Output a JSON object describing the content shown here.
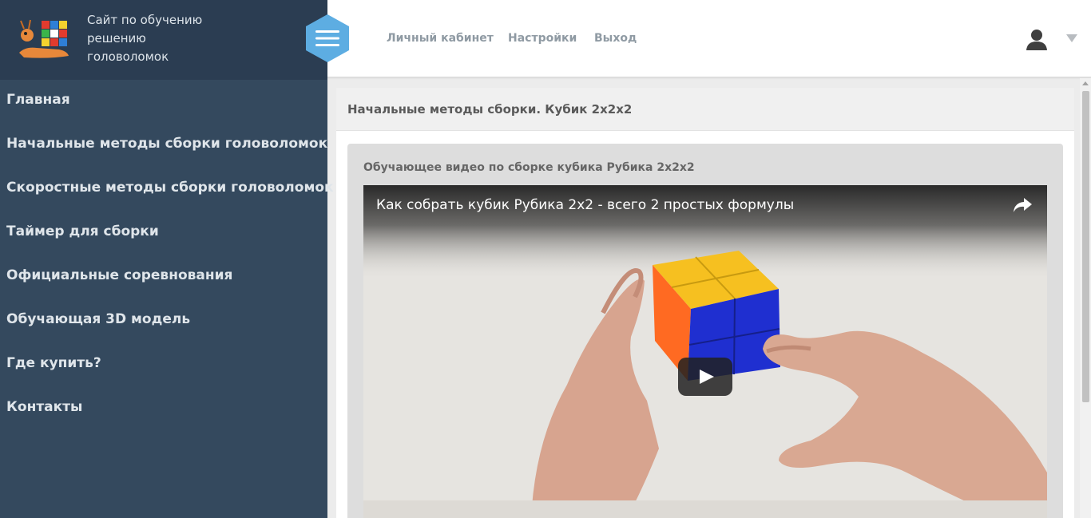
{
  "brand": {
    "line1": "Сайт по обучению",
    "line2": "решению",
    "line3": "головоломок"
  },
  "sidebar": {
    "items": [
      {
        "label": "Главная"
      },
      {
        "label": "Начальные методы сборки головоломок"
      },
      {
        "label": "Скоростные методы сборки головоломок"
      },
      {
        "label": "Таймер для сборки"
      },
      {
        "label": "Официальные соревнования"
      },
      {
        "label": "Обучающая 3D модель"
      },
      {
        "label": "Где купить?"
      },
      {
        "label": "Контакты"
      }
    ]
  },
  "topnav": {
    "links": [
      {
        "label": "Личный кабинет"
      },
      {
        "label": "Настройки"
      },
      {
        "label": "Выход"
      }
    ]
  },
  "main": {
    "title": "Начальные методы сборки. Кубик 2x2x2",
    "video_section_title": "Обучающее видео по сборке кубика Рубика 2x2x2",
    "video": {
      "title": "Как собрать кубик Рубика 2x2 - всего 2 простых формулы"
    }
  },
  "colors": {
    "sidebar_bg": "#34495e",
    "brand_bg": "#2b3d52",
    "hamburger": "#5dade2",
    "nav_link": "#8f9aa3"
  },
  "icons": [
    "logo-snail-icon",
    "hamburger-menu-icon",
    "user-icon",
    "chevron-down-icon",
    "share-icon",
    "play-icon"
  ]
}
